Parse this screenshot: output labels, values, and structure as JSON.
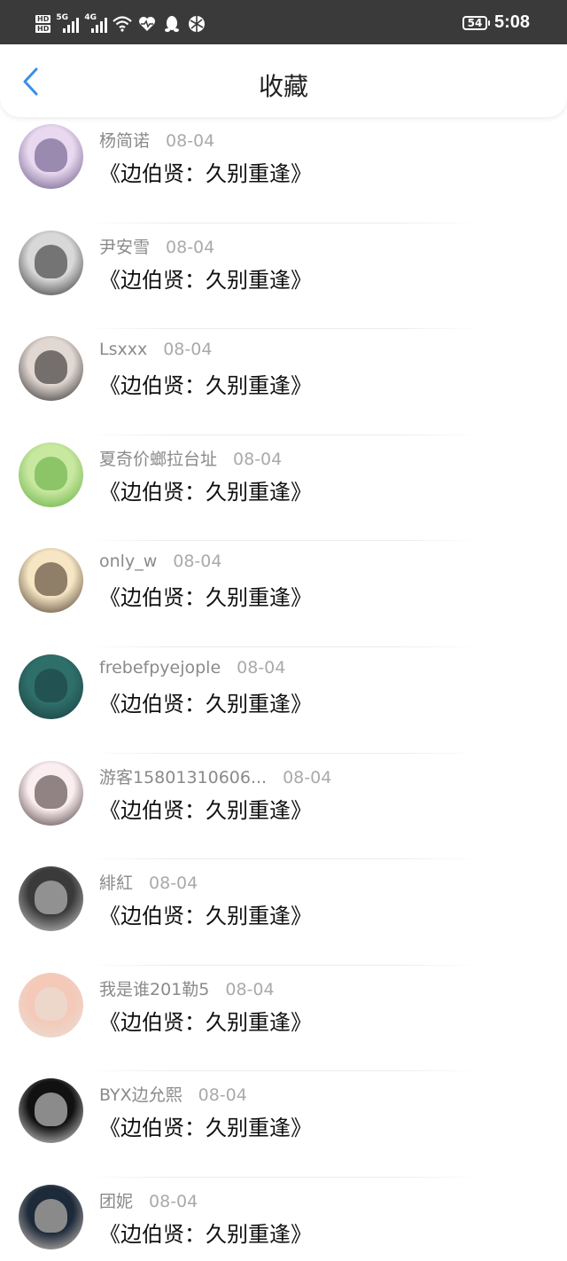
{
  "status_bar": {
    "hd_top": "HD",
    "hd_bottom": "HD",
    "sim1_tag": "5G",
    "sim2_tag": "4G",
    "battery": "54",
    "time": "5:08",
    "icons": [
      "wifi-icon",
      "heartbeat-icon",
      "qq-icon",
      "browser-icon"
    ]
  },
  "header": {
    "title": "收藏",
    "back_icon": "chevron-left-icon",
    "accent_color": "#3a8ee6"
  },
  "items": [
    {
      "user": "杨简诺",
      "date": "08-04",
      "title": "《边伯贤：久别重逢》",
      "avatar_colors": [
        "#e9d8ef",
        "#5a4a7a"
      ]
    },
    {
      "user": "尹安雪",
      "date": "08-04",
      "title": "《边伯贤：久别重逢》",
      "avatar_colors": [
        "#d8d8d8",
        "#222222"
      ]
    },
    {
      "user": "Lsxxx",
      "date": "08-04",
      "title": "《边伯贤：久别重逢》",
      "avatar_colors": [
        "#e2d8d2",
        "#1a1a1a"
      ]
    },
    {
      "user": "夏奇价螂拉台址",
      "date": "08-04",
      "title": "《边伯贤：久别重逢》",
      "avatar_colors": [
        "#c8e8a0",
        "#5aa838"
      ]
    },
    {
      "user": "only_w",
      "date": "08-04",
      "title": "《边伯贤：久别重逢》",
      "avatar_colors": [
        "#f6e6c4",
        "#3b2a1e"
      ]
    },
    {
      "user": "frebefpyejople",
      "date": "08-04",
      "title": "《边伯贤：久别重逢》",
      "avatar_colors": [
        "#2f6f6a",
        "#173a3c"
      ]
    },
    {
      "user": "游客15801310606...",
      "date": "08-04",
      "title": "《边伯贤：久别重逢》",
      "avatar_colors": [
        "#fbeef0",
        "#3a2a2a"
      ]
    },
    {
      "user": "緋紅",
      "date": "08-04",
      "title": "《边伯贤：久别重逢》",
      "avatar_colors": [
        "#3a3a3a",
        "#d8d8d8"
      ]
    },
    {
      "user": "我是谁201勒5",
      "date": "08-04",
      "title": "《边伯贤：久别重逢》",
      "avatar_colors": [
        "#f4c9b8",
        "#e8e0d8"
      ]
    },
    {
      "user": "BYX边允熙",
      "date": "08-04",
      "title": "《边伯贤：久别重逢》",
      "avatar_colors": [
        "#111111",
        "#f0f0f0"
      ]
    },
    {
      "user": "团妮",
      "date": "08-04",
      "title": "《边伯贤：久别重逢》",
      "avatar_colors": [
        "#1c2a3a",
        "#e8d8cc"
      ]
    }
  ]
}
